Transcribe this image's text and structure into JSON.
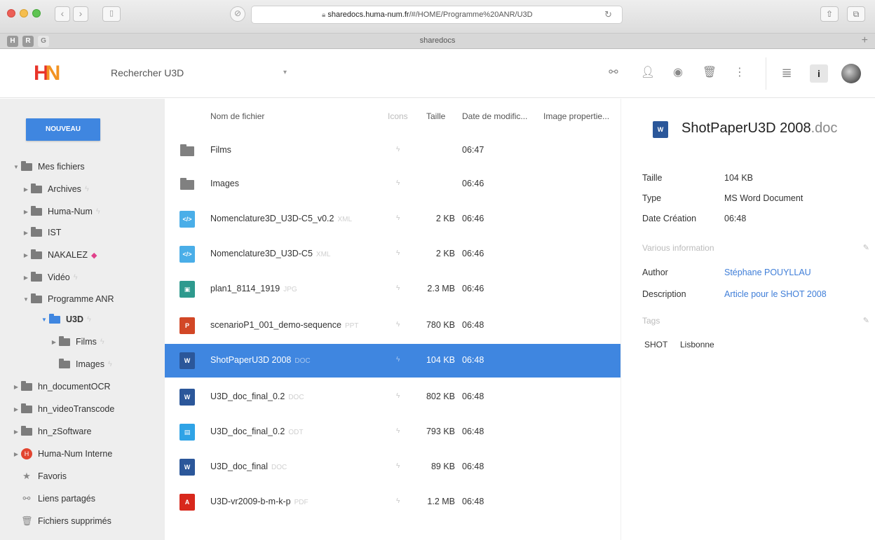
{
  "browser": {
    "url_host": "sharedocs.huma-num.fr",
    "url_path": "/#/HOME/Programme%20ANR/U3D",
    "tab_title": "sharedocs",
    "bookmarks": [
      "H",
      "R",
      "G"
    ]
  },
  "header": {
    "logo_h": "H",
    "logo_n": "N",
    "search_label": "Rechercher U3D"
  },
  "sidebar": {
    "new_button": "NOUVEAU",
    "tree": [
      {
        "label": "Mes fichiers"
      },
      {
        "label": "Archives"
      },
      {
        "label": "Huma-Num"
      },
      {
        "label": "IST"
      },
      {
        "label": "NAKALEZ"
      },
      {
        "label": "Vidéo"
      },
      {
        "label": "Programme ANR"
      },
      {
        "label": "U3D"
      },
      {
        "label": "Films"
      },
      {
        "label": "Images"
      },
      {
        "label": "hn_documentOCR"
      },
      {
        "label": "hn_videoTranscode"
      },
      {
        "label": "hn_zSoftware"
      },
      {
        "label": "Huma-Num Interne"
      },
      {
        "label": "Favoris"
      },
      {
        "label": "Liens partagés"
      },
      {
        "label": "Fichiers supprimés"
      }
    ]
  },
  "filelist": {
    "columns": {
      "name": "Nom de fichier",
      "icons": "Icons",
      "size": "Taille",
      "date": "Date de modific...",
      "props": "Image propertie..."
    },
    "rows": [
      {
        "name": "Films",
        "ext": "",
        "size": "",
        "date": "06:47",
        "type": "folder"
      },
      {
        "name": "Images",
        "ext": "",
        "size": "",
        "date": "06:46",
        "type": "folder"
      },
      {
        "name": "Nomenclature3D_U3D-C5_v0.2",
        "ext": "XML",
        "size": "2 KB",
        "date": "06:46",
        "type": "xml"
      },
      {
        "name": "Nomenclature3D_U3D-C5",
        "ext": "XML",
        "size": "2 KB",
        "date": "06:46",
        "type": "xml"
      },
      {
        "name": "plan1_8114_1919",
        "ext": "JPG",
        "size": "2.3 MB",
        "date": "06:46",
        "type": "jpg"
      },
      {
        "name": "scenarioP1_001_demo-sequence",
        "ext": "PPT",
        "size": "780 KB",
        "date": "06:48",
        "type": "ppt"
      },
      {
        "name": "ShotPaperU3D 2008",
        "ext": "DOC",
        "size": "104 KB",
        "date": "06:48",
        "type": "doc"
      },
      {
        "name": "U3D_doc_final_0.2",
        "ext": "DOC",
        "size": "802 KB",
        "date": "06:48",
        "type": "doc"
      },
      {
        "name": "U3D_doc_final_0.2",
        "ext": "ODT",
        "size": "793 KB",
        "date": "06:48",
        "type": "odt"
      },
      {
        "name": "U3D_doc_final",
        "ext": "DOC",
        "size": "89 KB",
        "date": "06:48",
        "type": "doc"
      },
      {
        "name": "U3D-vr2009-b-m-k-p",
        "ext": "PDF",
        "size": "1.2 MB",
        "date": "06:48",
        "type": "pdf"
      }
    ]
  },
  "detail": {
    "title": "ShotPaperU3D 2008",
    "title_ext": ".doc",
    "size_label": "Taille",
    "size_value": "104 KB",
    "type_label": "Type",
    "type_value": "MS Word Document",
    "created_label": "Date Création",
    "created_value": "06:48",
    "various_label": "Various information",
    "author_label": "Author",
    "author_value": "Stéphane POUYLLAU",
    "desc_label": "Description",
    "desc_value": "Article pour le SHOT 2008",
    "tags_label": "Tags",
    "tags": [
      "SHOT",
      "Lisbonne"
    ]
  }
}
